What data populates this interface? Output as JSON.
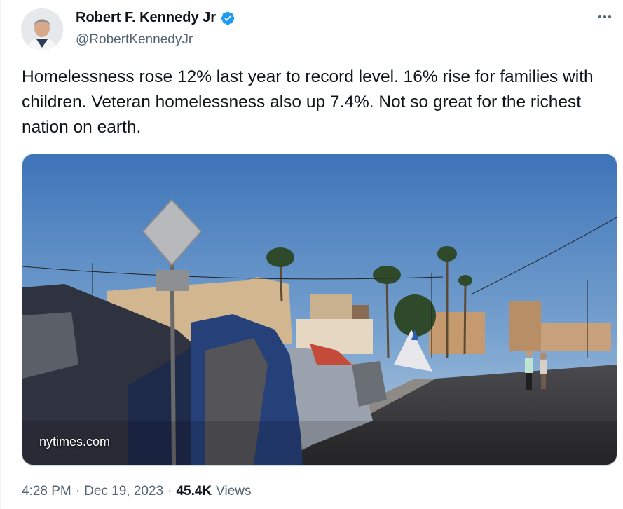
{
  "tweet": {
    "author_name": "Robert F. Kennedy Jr",
    "handle": "@RobertKennedyJr",
    "text": "Homelessness rose 12% last year to record level. 16% rise for families with children. Veteran homelessness also up 7.4%. Not so great for the richest nation on earth.",
    "card_domain": "nytimes.com",
    "time": "4:28 PM",
    "date": "Dec 19, 2023",
    "separator": "·",
    "views_count": "45.4K",
    "views_label": "Views"
  },
  "icons": {
    "verified": "verified-badge-icon",
    "more": "more-options-icon"
  },
  "colors": {
    "verified_blue": "#1d9bf0",
    "secondary_text": "#536471",
    "primary_text": "#0f1419"
  }
}
